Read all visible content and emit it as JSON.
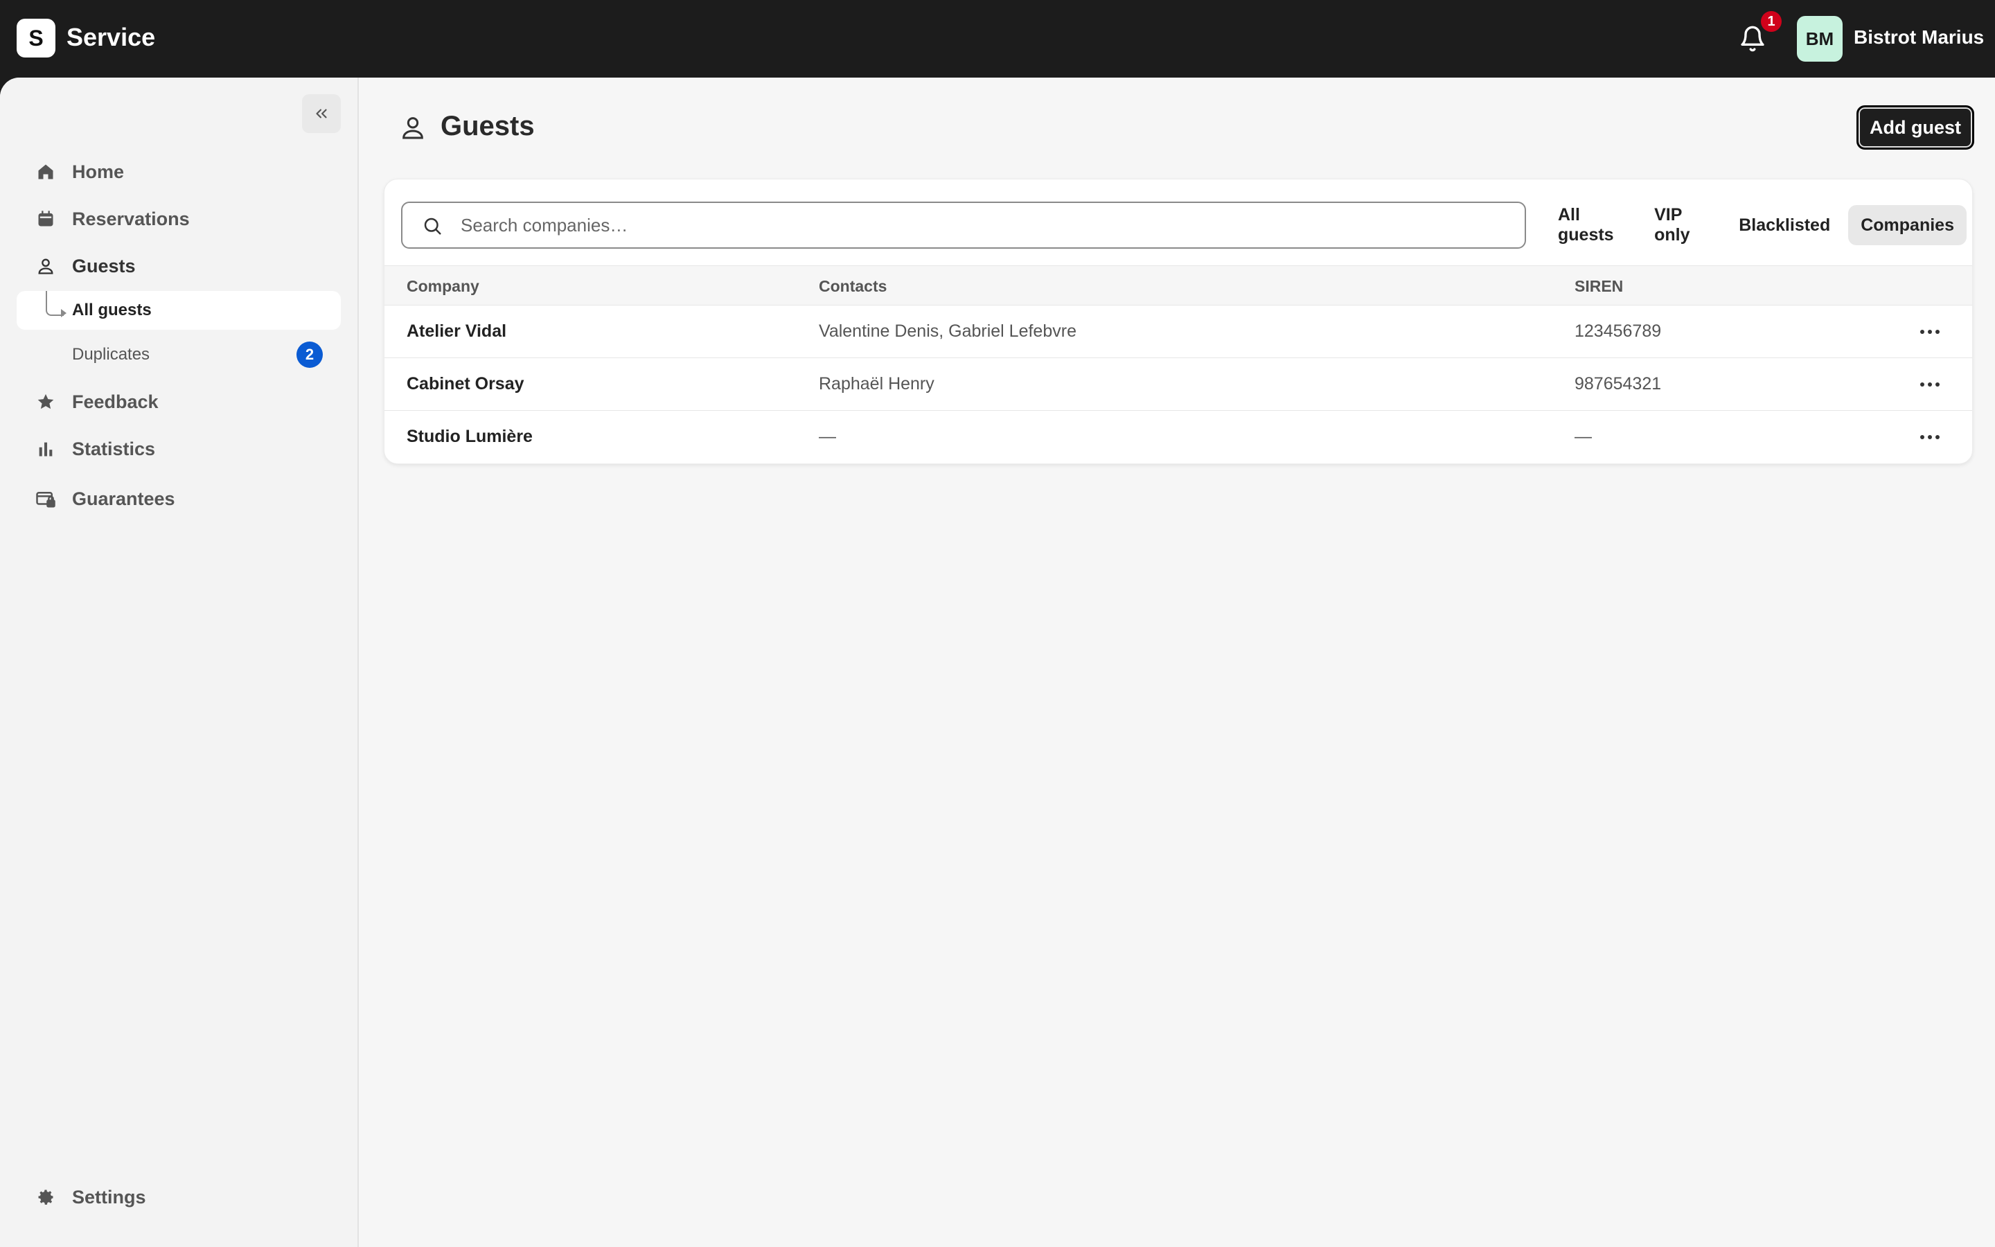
{
  "app": {
    "logo_letter": "S",
    "title": "Service"
  },
  "header": {
    "notification_count": "1",
    "avatar_initials": "BM",
    "user_name": "Bistrot Marius"
  },
  "sidebar": {
    "items": [
      {
        "label": "Home",
        "icon": "home-icon"
      },
      {
        "label": "Reservations",
        "icon": "calendar-icon"
      },
      {
        "label": "Guests",
        "icon": "person-icon"
      },
      {
        "label": "Feedback",
        "icon": "star-icon"
      },
      {
        "label": "Statistics",
        "icon": "bar-chart-icon"
      },
      {
        "label": "Guarantees",
        "icon": "card-lock-icon"
      }
    ],
    "sub_items": [
      {
        "label": "All guests"
      },
      {
        "label": "Duplicates",
        "badge": "2"
      }
    ],
    "settings_label": "Settings"
  },
  "page": {
    "title": "Guests",
    "add_button": "Add guest"
  },
  "search": {
    "placeholder": "Search companies…",
    "value": ""
  },
  "filters": [
    "All guests",
    "VIP only",
    "Blacklisted",
    "Companies"
  ],
  "active_filter": "Companies",
  "table": {
    "columns": [
      "Company",
      "Contacts",
      "SIREN"
    ],
    "rows": [
      {
        "company": "Atelier Vidal",
        "contacts": "Valentine Denis, Gabriel Lefebvre",
        "siren": "123456789"
      },
      {
        "company": "Cabinet Orsay",
        "contacts": "Raphaël Henry",
        "siren": "987654321"
      },
      {
        "company": "Studio Lumière",
        "contacts": "—",
        "siren": "—"
      }
    ]
  },
  "colors": {
    "topbar": "#1c1c1c",
    "badge_red": "#d0021b",
    "badge_blue": "#0a5bd3",
    "avatar_bg": "#c7f2de"
  }
}
